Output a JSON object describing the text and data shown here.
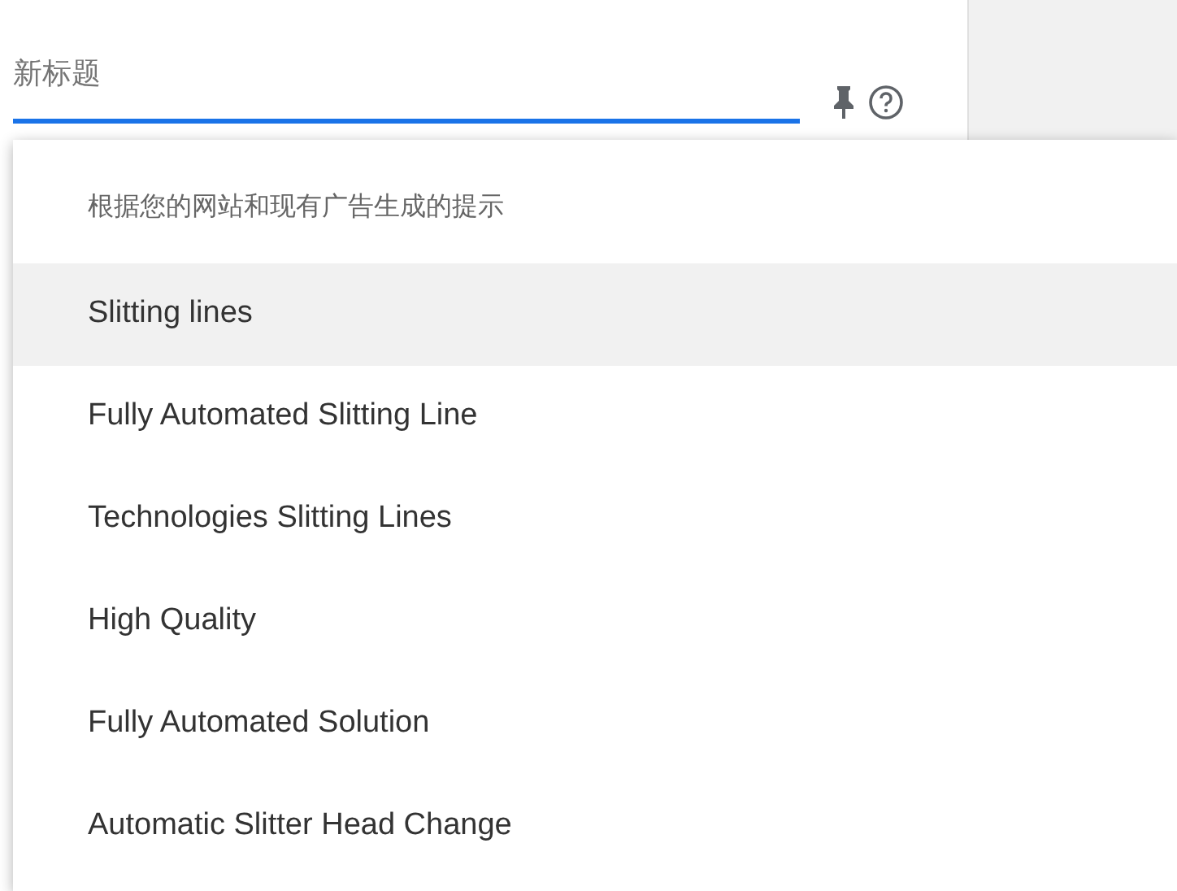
{
  "field": {
    "placeholder": "新标题",
    "focused": true
  },
  "suggestions": {
    "heading": "根据您的网站和现有广告生成的提示",
    "items": [
      {
        "label": "Slitting lines",
        "selected": true
      },
      {
        "label": "Fully Automated Slitting Line",
        "selected": false
      },
      {
        "label": "Technologies Slitting Lines",
        "selected": false
      },
      {
        "label": "High Quality",
        "selected": false
      },
      {
        "label": "Fully Automated Solution",
        "selected": false
      },
      {
        "label": "Automatic Slitter Head Change",
        "selected": false
      }
    ]
  }
}
